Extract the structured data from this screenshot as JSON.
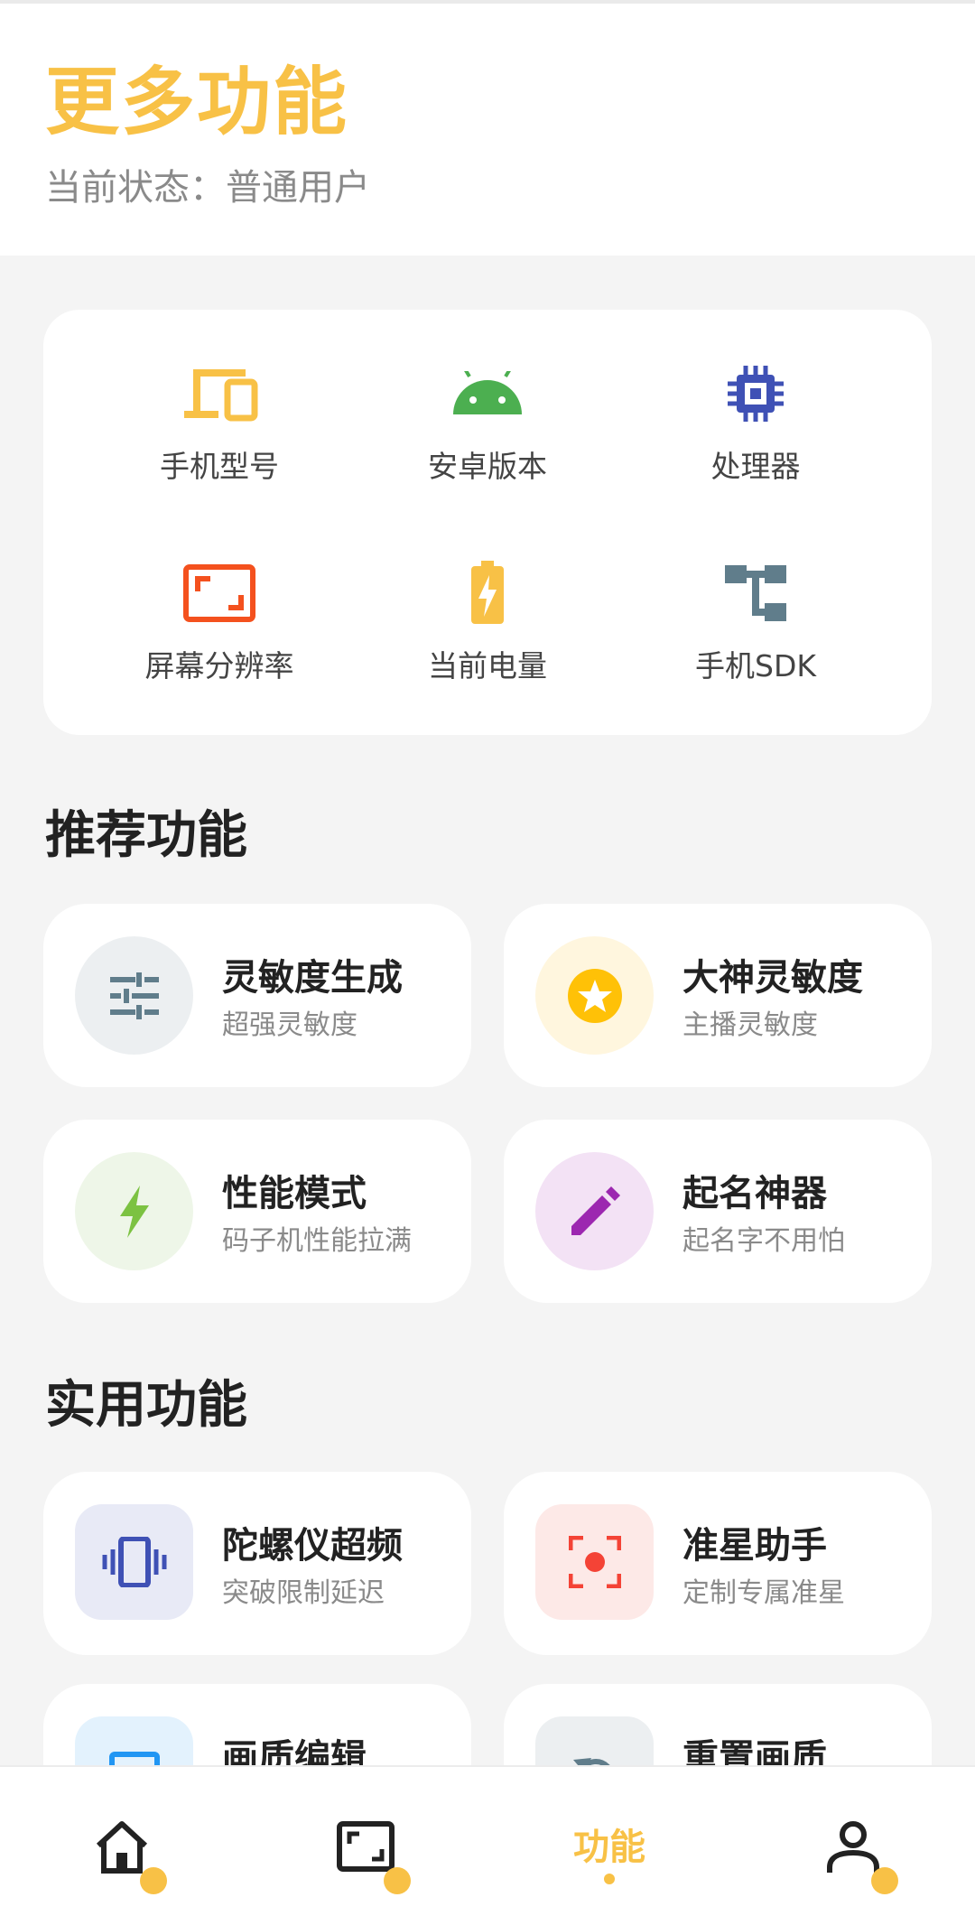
{
  "header": {
    "title": "更多功能",
    "status": "当前状态：普通用户"
  },
  "device_info": {
    "items": [
      {
        "label": "手机型号",
        "icon": "devices-icon",
        "color": "#f8c146"
      },
      {
        "label": "安卓版本",
        "icon": "android-icon",
        "color": "#4caf50"
      },
      {
        "label": "处理器",
        "icon": "chip-icon",
        "color": "#3f51b5"
      },
      {
        "label": "屏幕分辨率",
        "icon": "screen-resolution-icon",
        "color": "#f4511e"
      },
      {
        "label": "当前电量",
        "icon": "battery-charging-icon",
        "color": "#f8c146"
      },
      {
        "label": "手机SDK",
        "icon": "sdk-tree-icon",
        "color": "#607d8b"
      }
    ]
  },
  "recommended": {
    "title": "推荐功能",
    "items": [
      {
        "title": "灵敏度生成",
        "subtitle": "超强灵敏度",
        "icon": "sliders-icon"
      },
      {
        "title": "大神灵敏度",
        "subtitle": "主播灵敏度",
        "icon": "star-icon"
      },
      {
        "title": "性能模式",
        "subtitle": "码子机性能拉满",
        "icon": "lightning-icon"
      },
      {
        "title": "起名神器",
        "subtitle": "起名字不用怕",
        "icon": "pencil-icon"
      }
    ]
  },
  "utility": {
    "title": "实用功能",
    "items": [
      {
        "title": "陀螺仪超频",
        "subtitle": "突破限制延迟",
        "icon": "vibration-icon"
      },
      {
        "title": "准星助手",
        "subtitle": "定制专属准星",
        "icon": "crosshair-icon"
      },
      {
        "title": "画质编辑",
        "subtitle": "",
        "icon": "screen-icon"
      },
      {
        "title": "重置画质",
        "subtitle": "",
        "icon": "reset-icon"
      }
    ]
  },
  "tabbar": {
    "items": [
      {
        "icon": "home-icon"
      },
      {
        "icon": "screen-frame-icon"
      },
      {
        "label": "功能",
        "active": true
      },
      {
        "icon": "profile-icon"
      }
    ],
    "accent": "#f8c146"
  }
}
